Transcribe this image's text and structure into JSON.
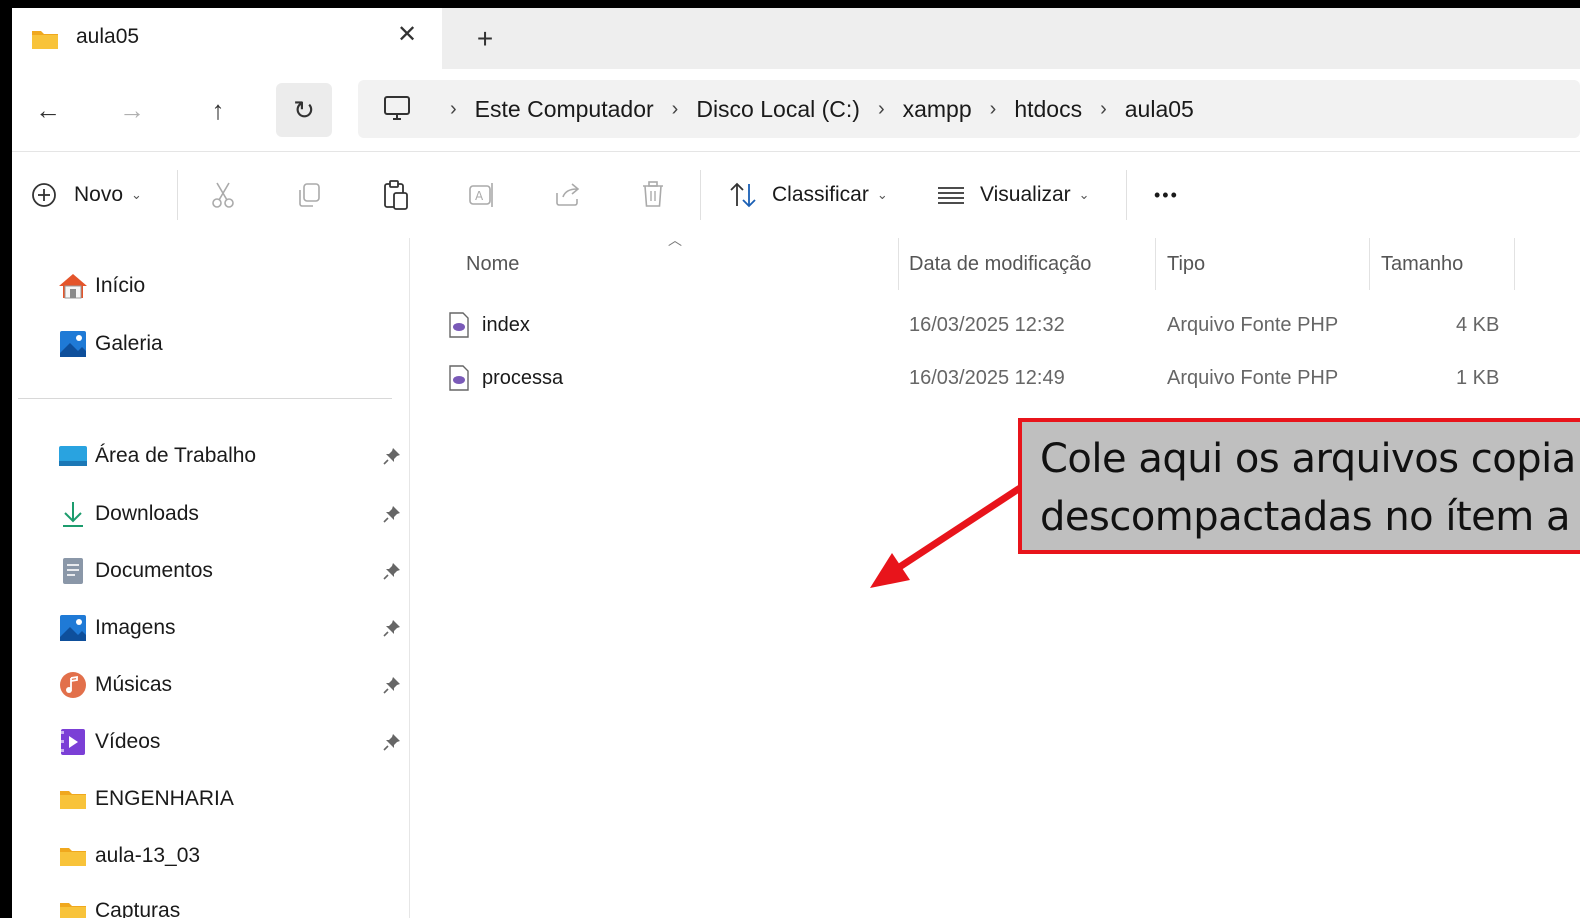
{
  "tab": {
    "title": "aula05",
    "close_label": "✕",
    "new_tab_label": "+"
  },
  "nav": {
    "back": "←",
    "forward": "→",
    "up": "↑",
    "refresh": "↻"
  },
  "breadcrumb": [
    "Este Computador",
    "Disco Local (C:)",
    "xampp",
    "htdocs",
    "aula05"
  ],
  "breadcrumb_separator": "›",
  "toolbar": {
    "new_label": "Novo",
    "sort_label": "Classificar",
    "view_label": "Visualizar",
    "more_label": "•••"
  },
  "sidebar": {
    "top_items": [
      {
        "label": "Início",
        "icon": "home-icon"
      },
      {
        "label": "Galeria",
        "icon": "gallery-icon"
      }
    ],
    "pinned_items": [
      {
        "label": "Área de Trabalho",
        "icon": "desktop-icon"
      },
      {
        "label": "Downloads",
        "icon": "download-icon"
      },
      {
        "label": "Documentos",
        "icon": "document-icon"
      },
      {
        "label": "Imagens",
        "icon": "pictures-icon"
      },
      {
        "label": "Músicas",
        "icon": "music-icon"
      },
      {
        "label": "Vídeos",
        "icon": "video-icon"
      }
    ],
    "folders": [
      {
        "label": "ENGENHARIA",
        "icon": "folder-icon"
      },
      {
        "label": "aula-13_03",
        "icon": "folder-icon"
      },
      {
        "label": "Capturas",
        "icon": "folder-icon"
      }
    ]
  },
  "columns": {
    "name": "Nome",
    "modified": "Data de modificação",
    "type": "Tipo",
    "size": "Tamanho"
  },
  "files": [
    {
      "name": "index",
      "modified": "16/03/2025 12:32",
      "type": "Arquivo Fonte PHP",
      "size": "4 KB"
    },
    {
      "name": "processa",
      "modified": "16/03/2025 12:49",
      "type": "Arquivo Fonte PHP",
      "size": "1 KB"
    }
  ],
  "callout": {
    "line1": "Cole aqui os arquivos copia",
    "line2": "descompactadas no ítem a"
  },
  "colors": {
    "accent_red": "#e8141b",
    "callout_bg": "#bfbfbf",
    "folder_yellow": "#f8c33a"
  }
}
